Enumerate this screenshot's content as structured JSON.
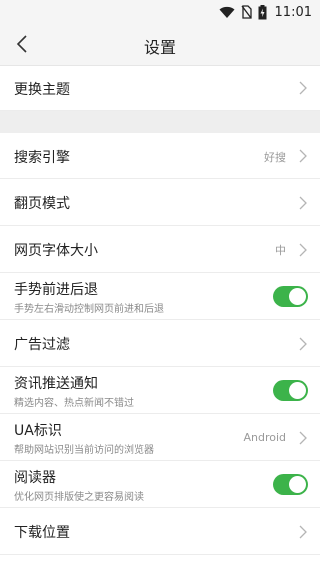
{
  "status_bar": {
    "time": "11:01"
  },
  "header": {
    "title": "设置"
  },
  "rows": {
    "theme": {
      "label": "更换主题"
    },
    "search_engine": {
      "label": "搜索引擎",
      "value": "好搜"
    },
    "page_mode": {
      "label": "翻页模式"
    },
    "font_size": {
      "label": "网页字体大小",
      "value": "中"
    },
    "gesture": {
      "label": "手势前进后退",
      "sub": "手势左右滑动控制网页前进和后退",
      "enabled": true
    },
    "ad_filter": {
      "label": "广告过滤"
    },
    "news_push": {
      "label": "资讯推送通知",
      "sub": "精选内容、热点新闻不错过",
      "enabled": true
    },
    "ua": {
      "label": "UA标识",
      "sub": "帮助网站识别当前访问的浏览器",
      "value": "Android"
    },
    "reader": {
      "label": "阅读器",
      "sub": "优化网页排版使之更容易阅读",
      "enabled": true
    },
    "download": {
      "label": "下载位置"
    }
  },
  "colors": {
    "toggle_on": "#3cb34a",
    "chevron": "#b5b5b5"
  }
}
